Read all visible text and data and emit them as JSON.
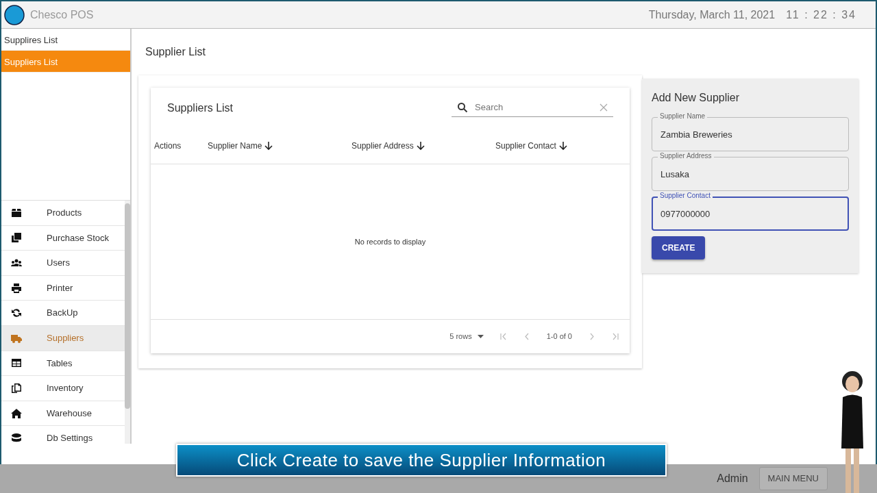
{
  "header": {
    "app_name": "Chesco POS",
    "date": "Thursday,  March 11,  2021",
    "time": "11 : 22 : 34"
  },
  "submenu": [
    {
      "label": "Supplires List",
      "selected": false
    },
    {
      "label": "Suppliers List",
      "selected": true
    }
  ],
  "sidebar": {
    "items": [
      {
        "label": "Products",
        "selected": false
      },
      {
        "label": "Purchase Stock",
        "selected": false
      },
      {
        "label": "Users",
        "selected": false
      },
      {
        "label": "Printer",
        "selected": false
      },
      {
        "label": "BackUp",
        "selected": false
      },
      {
        "label": "Suppliers",
        "selected": true
      },
      {
        "label": "Tables",
        "selected": false
      },
      {
        "label": "Inventory",
        "selected": false
      },
      {
        "label": "Warehouse",
        "selected": false
      },
      {
        "label": "Db Settings",
        "selected": false
      }
    ]
  },
  "page_title": "Supplier List",
  "table": {
    "title": "Suppliers List",
    "search": {
      "placeholder": "Search"
    },
    "columns": [
      {
        "label": "Actions",
        "sortable": false
      },
      {
        "label": "Supplier Name",
        "sortable": true
      },
      {
        "label": "Supplier Address",
        "sortable": true
      },
      {
        "label": "Supplier Contact",
        "sortable": true
      }
    ],
    "empty_message": "No records to display",
    "pagination": {
      "rows": "5 rows",
      "range": "1-0 of 0"
    }
  },
  "form": {
    "title": "Add New Supplier",
    "fields": [
      {
        "label": "Supplier Name",
        "value": "Zambia Breweries",
        "focused": false
      },
      {
        "label": "Supplier Address",
        "value": "Lusaka",
        "focused": false
      },
      {
        "label": "Supplier Contact",
        "value": "0977000000",
        "focused": true
      }
    ],
    "button": "CREATE"
  },
  "callout": "Click Create to save the Supplier Information",
  "status_bar": {
    "user": "Admin",
    "button": "MAIN MENU"
  }
}
